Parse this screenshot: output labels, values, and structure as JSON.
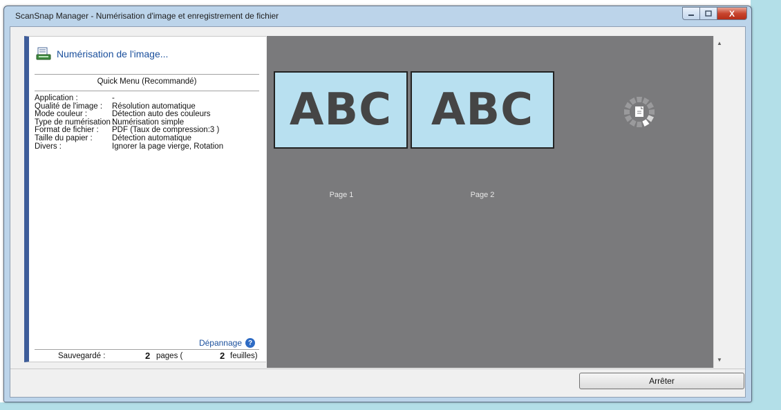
{
  "window": {
    "title": "ScanSnap Manager - Numérisation d'image et enregistrement de fichier",
    "minimize_icon": "minimize-icon",
    "maximize_icon": "maximize-icon",
    "close_glyph": "X"
  },
  "left_panel": {
    "heading": "Numérisation de l'image...",
    "profile": "Quick Menu (Recommandé)",
    "settings": [
      {
        "label": "Application :",
        "value": "-"
      },
      {
        "label": "Qualité de l'image :",
        "value": "Résolution automatique"
      },
      {
        "label": "Mode couleur :",
        "value": "Détection auto des couleurs"
      },
      {
        "label": "Type de numérisation :",
        "value": "Numérisation simple"
      },
      {
        "label": "Format de fichier :",
        "value": "PDF (Taux de compression:3 )"
      },
      {
        "label": "Taille du papier :",
        "value": "Détection automatique"
      },
      {
        "label": "Divers :",
        "value": "Ignorer la page vierge, Rotation"
      }
    ],
    "troubleshoot_link": "Dépannage",
    "help_glyph": "?",
    "saved": {
      "label": "Sauvegardé :",
      "pages_count": "2",
      "pages_text": "pages (",
      "sheets_count": "2",
      "sheets_text": "feuilles)"
    }
  },
  "preview": {
    "pages": [
      {
        "thumb_text": "ABC",
        "label": "Page 1"
      },
      {
        "thumb_text": "ABC",
        "label": "Page 2"
      }
    ],
    "scroll_up_glyph": "▲",
    "scroll_down_glyph": "▼"
  },
  "footer": {
    "stop_button": "Arrêter"
  },
  "colors": {
    "accent_link": "#1a4f9c",
    "panel_bar": "#3e5d9a",
    "preview_bg": "#7a7a7c",
    "thumb_bg": "#b8e0f0"
  }
}
